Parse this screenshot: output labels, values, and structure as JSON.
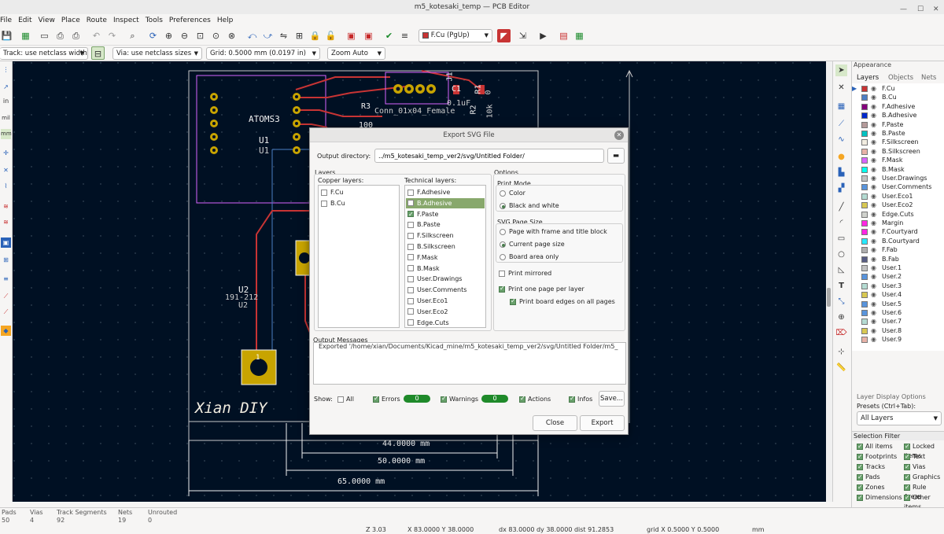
{
  "window": {
    "title": "m5_kotesaki_temp — PCB Editor"
  },
  "menu": [
    "File",
    "Edit",
    "View",
    "Place",
    "Route",
    "Inspect",
    "Tools",
    "Preferences",
    "Help"
  ],
  "toolbar": {
    "active_layer": "F.Cu (PgUp)"
  },
  "toolbar2": {
    "track": "Track: use netclass width",
    "via": "Via: use netclass sizes",
    "grid": "Grid: 0.5000 mm (0.0197 in)",
    "zoom": "Zoom Auto"
  },
  "left_toolbar_labels": [
    "in",
    "mil",
    "mm"
  ],
  "pcb": {
    "labels": {
      "atom": "ATOMS3",
      "u1a": "U1",
      "u1b": "U1",
      "u2a": "U2",
      "u2b": "191-212",
      "u2c": "U2",
      "conn": "Conn_01x04_Female",
      "j1": "J1",
      "c1": "C1",
      "cval": "0.1uF",
      "r3": "R3",
      "r3v": "100",
      "r2": "R2",
      "r2v": "10k",
      "r1": "R1",
      "r1v": "0",
      "pad1": "1",
      "brand": "Xian DIY"
    },
    "dimensions": [
      "44.0000 mm",
      "50.0000 mm",
      "65.0000 mm"
    ]
  },
  "dialog": {
    "title": "Export SVG File",
    "output_dir_label": "Output directory:",
    "output_dir": "../m5_kotesaki_temp_ver2/svg/Untitled Folder/",
    "layers_label": "Layers",
    "copper_label": "Copper layers:",
    "copper": [
      {
        "name": "F.Cu",
        "checked": false
      },
      {
        "name": "B.Cu",
        "checked": false
      }
    ],
    "tech_label": "Technical layers:",
    "tech": [
      {
        "name": "F.Adhesive",
        "checked": false
      },
      {
        "name": "B.Adhesive",
        "checked": false,
        "selected": true
      },
      {
        "name": "F.Paste",
        "checked": true
      },
      {
        "name": "B.Paste",
        "checked": false
      },
      {
        "name": "F.Silkscreen",
        "checked": false
      },
      {
        "name": "B.Silkscreen",
        "checked": false
      },
      {
        "name": "F.Mask",
        "checked": false
      },
      {
        "name": "B.Mask",
        "checked": false
      },
      {
        "name": "User.Drawings",
        "checked": false
      },
      {
        "name": "User.Comments",
        "checked": false
      },
      {
        "name": "User.Eco1",
        "checked": false
      },
      {
        "name": "User.Eco2",
        "checked": false
      },
      {
        "name": "Edge.Cuts",
        "checked": false
      }
    ],
    "options_label": "Options",
    "print_mode_label": "Print Mode",
    "print_mode": [
      {
        "label": "Color",
        "on": false
      },
      {
        "label": "Black and white",
        "on": true
      }
    ],
    "page_size_label": "SVG Page Size",
    "page_size": [
      {
        "label": "Page with frame and title block",
        "on": false
      },
      {
        "label": "Current page size",
        "on": true
      },
      {
        "label": "Board area only",
        "on": false
      }
    ],
    "print_mirrored": "Print mirrored",
    "one_page": "Print one page per layer",
    "board_edges": "Print board edges on all pages",
    "messages_label": "Output Messages",
    "message": "Exported '/home/xian/Documents/Kicad_mine/m5_kotesaki_temp_ver2/svg/Untitled Folder/m5_",
    "show_label": "Show:",
    "filters": {
      "all": "All",
      "errors": "Errors",
      "warnings": "Warnings",
      "actions": "Actions",
      "infos": "Infos"
    },
    "errors_count": "0",
    "warnings_count": "0",
    "save_label": "Save...",
    "close_label": "Close",
    "export_label": "Export"
  },
  "appearance": {
    "title": "Appearance",
    "tabs": [
      "Layers",
      "Objects",
      "Nets"
    ],
    "layers": [
      {
        "name": "F.Cu",
        "color": "#c83434"
      },
      {
        "name": "B.Cu",
        "color": "#4d7fc4"
      },
      {
        "name": "F.Adhesive",
        "color": "#84007c"
      },
      {
        "name": "B.Adhesive",
        "color": "#0029cc"
      },
      {
        "name": "F.Paste",
        "color": "#b49a9a"
      },
      {
        "name": "B.Paste",
        "color": "#00c2c2"
      },
      {
        "name": "F.Silkscreen",
        "color": "#f2ede1"
      },
      {
        "name": "B.Silkscreen",
        "color": "#e8b2a7"
      },
      {
        "name": "F.Mask",
        "color": "#d864ff"
      },
      {
        "name": "B.Mask",
        "color": "#02ffee"
      },
      {
        "name": "User.Drawings",
        "color": "#c2c2c2"
      },
      {
        "name": "User.Comments",
        "color": "#5994dc"
      },
      {
        "name": "User.Eco1",
        "color": "#b4dbd2"
      },
      {
        "name": "User.Eco2",
        "color": "#d8c852"
      },
      {
        "name": "Edge.Cuts",
        "color": "#d0d2cd"
      },
      {
        "name": "Margin",
        "color": "#ff26e2"
      },
      {
        "name": "F.Courtyard",
        "color": "#ff26e2"
      },
      {
        "name": "B.Courtyard",
        "color": "#26e9ff"
      },
      {
        "name": "F.Fab",
        "color": "#afafaf"
      },
      {
        "name": "B.Fab",
        "color": "#585d84"
      },
      {
        "name": "User.1",
        "color": "#c2c2c2"
      },
      {
        "name": "User.2",
        "color": "#5994dc"
      },
      {
        "name": "User.3",
        "color": "#b4dbd2"
      },
      {
        "name": "User.4",
        "color": "#d8c852"
      },
      {
        "name": "User.5",
        "color": "#5994dc"
      },
      {
        "name": "User.6",
        "color": "#5994dc"
      },
      {
        "name": "User.7",
        "color": "#b4dbd2"
      },
      {
        "name": "User.8",
        "color": "#d8c852"
      },
      {
        "name": "User.9",
        "color": "#e8b2a7"
      }
    ],
    "layer_display_options": "Layer Display Options",
    "presets_label": "Presets (Ctrl+Tab):",
    "preset": "All Layers",
    "selection_filter": "Selection Filter",
    "filters": [
      "All items",
      "Locked items",
      "Footprints",
      "Text",
      "Tracks",
      "Vias",
      "Pads",
      "Graphics",
      "Zones",
      "Rule Areas",
      "Dimensions",
      "Other items"
    ]
  },
  "status": {
    "headers": [
      "Pads",
      "Vias",
      "Track Segments",
      "Nets",
      "Unrouted"
    ],
    "values": [
      "50",
      "4",
      "92",
      "19",
      "0"
    ],
    "zoom": "Z 3.03",
    "xy": "X 83.0000  Y 38.0000",
    "dxy": "dx 83.0000  dy 38.0000  dist 91.2853",
    "grid": "grid X 0.5000  Y 0.5000",
    "units": "mm"
  }
}
